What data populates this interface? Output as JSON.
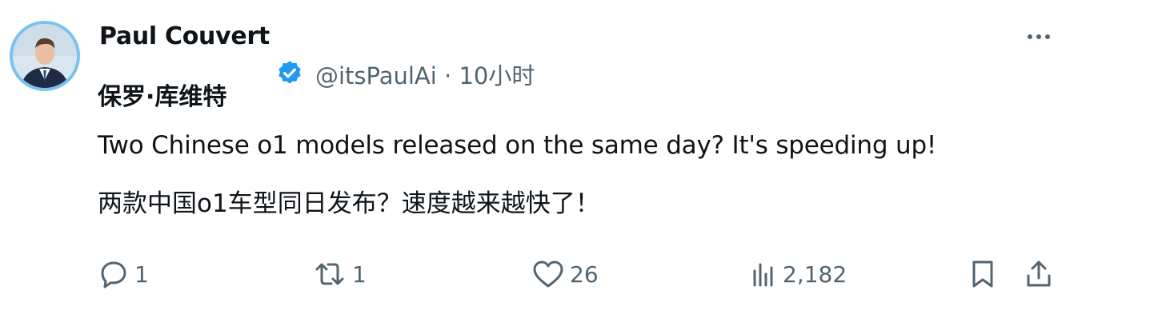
{
  "author": {
    "name": "Paul Couvert",
    "name_cn": "保罗·库维特",
    "handle": "@itsPaulAi",
    "time": "10小时"
  },
  "tweet": {
    "text_en": "Two Chinese o1 models released on the same day? It's speeding up!",
    "text_zh": "两款中国o1车型同日发布？速度越来越快了！"
  },
  "stats": {
    "replies": "1",
    "retweets": "1",
    "likes": "26",
    "views": "2,182"
  },
  "colors": {
    "verified": "#1d9bf0",
    "muted": "#536471",
    "text": "#0f1419"
  },
  "icons": [
    "avatar",
    "verified-badge-icon",
    "more-icon",
    "reply-icon",
    "retweet-icon",
    "like-icon",
    "views-icon",
    "bookmark-icon",
    "share-icon"
  ]
}
